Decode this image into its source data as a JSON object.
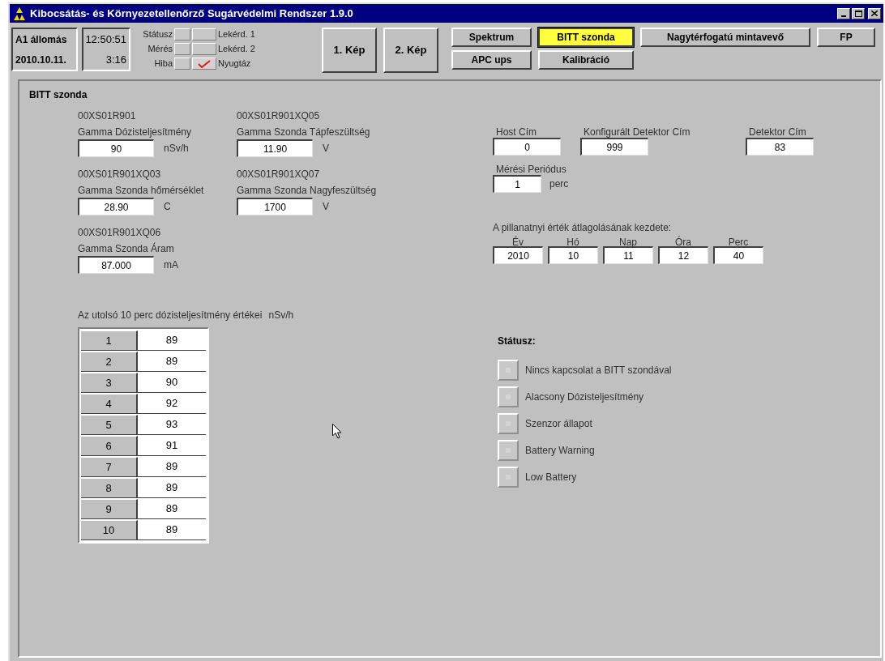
{
  "window": {
    "title": "Kibocsátás- és Környezetellenőrző Sugárvédelmi Rendszer 1.9.0"
  },
  "station": {
    "name": "A1 állomás",
    "date": "2010.10.11."
  },
  "clock": {
    "time": "12:50:51",
    "elapsed": "3:16"
  },
  "indicators": [
    {
      "label": "Státusz",
      "right_label": "Lekérd. 1",
      "checked": false
    },
    {
      "label": "Mérés",
      "right_label": "Lekérd. 2",
      "checked": false
    },
    {
      "label": "Hiba",
      "right_label": "Nyugtáz",
      "checked": true
    }
  ],
  "view_buttons": [
    "1. Kép",
    "2. Kép"
  ],
  "tabs": [
    {
      "label": "Spektrum",
      "selected": false
    },
    {
      "label": "BITT szonda",
      "selected": true
    },
    {
      "label": "Nagytérfogatú mintavevő",
      "selected": false
    },
    {
      "label": "FP",
      "selected": false
    },
    {
      "label": "APC ups",
      "selected": false
    },
    {
      "label": "Kalibráció",
      "selected": false
    }
  ],
  "panel": {
    "title": "BITT szonda",
    "measurements": [
      {
        "code": "00XS01R901",
        "label": "Gamma Dózisteljesítmény",
        "value": "90",
        "unit": "nSv/h"
      },
      {
        "code": "00XS01R901XQ05",
        "label": "Gamma Szonda Tápfeszültség",
        "value": "11.90",
        "unit": "V"
      },
      {
        "code": "00XS01R901XQ03",
        "label": "Gamma Szonda hőmérséklet",
        "value": "28.90",
        "unit": "C"
      },
      {
        "code": "00XS01R901XQ07",
        "label": "Gamma Szonda Nagyfeszültség",
        "value": "1700",
        "unit": "V"
      },
      {
        "code": "00XS01R901XQ06",
        "label": "Gamma Szonda Áram",
        "value": "87.000",
        "unit": "mA"
      }
    ],
    "addresses": [
      {
        "label": "Host Cím",
        "value": "0"
      },
      {
        "label": "Konfigurált Detektor Cím",
        "value": "999"
      },
      {
        "label": "Detektor Cím",
        "value": "83"
      }
    ],
    "period": {
      "label": "Mérési Periódus",
      "value": "1",
      "unit": "perc"
    },
    "averaging": {
      "title": "A pillanatnyi érték átlagolásának kezdete:",
      "fields": [
        {
          "label": "Év",
          "value": "2010"
        },
        {
          "label": "Hó",
          "value": "10"
        },
        {
          "label": "Nap",
          "value": "11"
        },
        {
          "label": "Óra",
          "value": "12"
        },
        {
          "label": "Perc",
          "value": "40"
        }
      ]
    },
    "history": {
      "title": "Az utolsó 10 perc dózisteljesítmény értékei",
      "unit": "nSv/h",
      "rows": [
        {
          "index": "1",
          "value": "89"
        },
        {
          "index": "2",
          "value": "89"
        },
        {
          "index": "3",
          "value": "90"
        },
        {
          "index": "4",
          "value": "92"
        },
        {
          "index": "5",
          "value": "93"
        },
        {
          "index": "6",
          "value": "91"
        },
        {
          "index": "7",
          "value": "89"
        },
        {
          "index": "8",
          "value": "89"
        },
        {
          "index": "9",
          "value": "89"
        },
        {
          "index": "10",
          "value": "89"
        }
      ]
    },
    "status": {
      "title": "Státusz:",
      "items": [
        {
          "label": "Nincs kapcsolat a BITT szondával",
          "on": false
        },
        {
          "label": "Alacsony Dózisteljesítmény",
          "on": false
        },
        {
          "label": "Szenzor állapot",
          "on": false
        },
        {
          "label": "Battery Warning",
          "on": false
        },
        {
          "label": "Low Battery",
          "on": false
        }
      ]
    }
  }
}
